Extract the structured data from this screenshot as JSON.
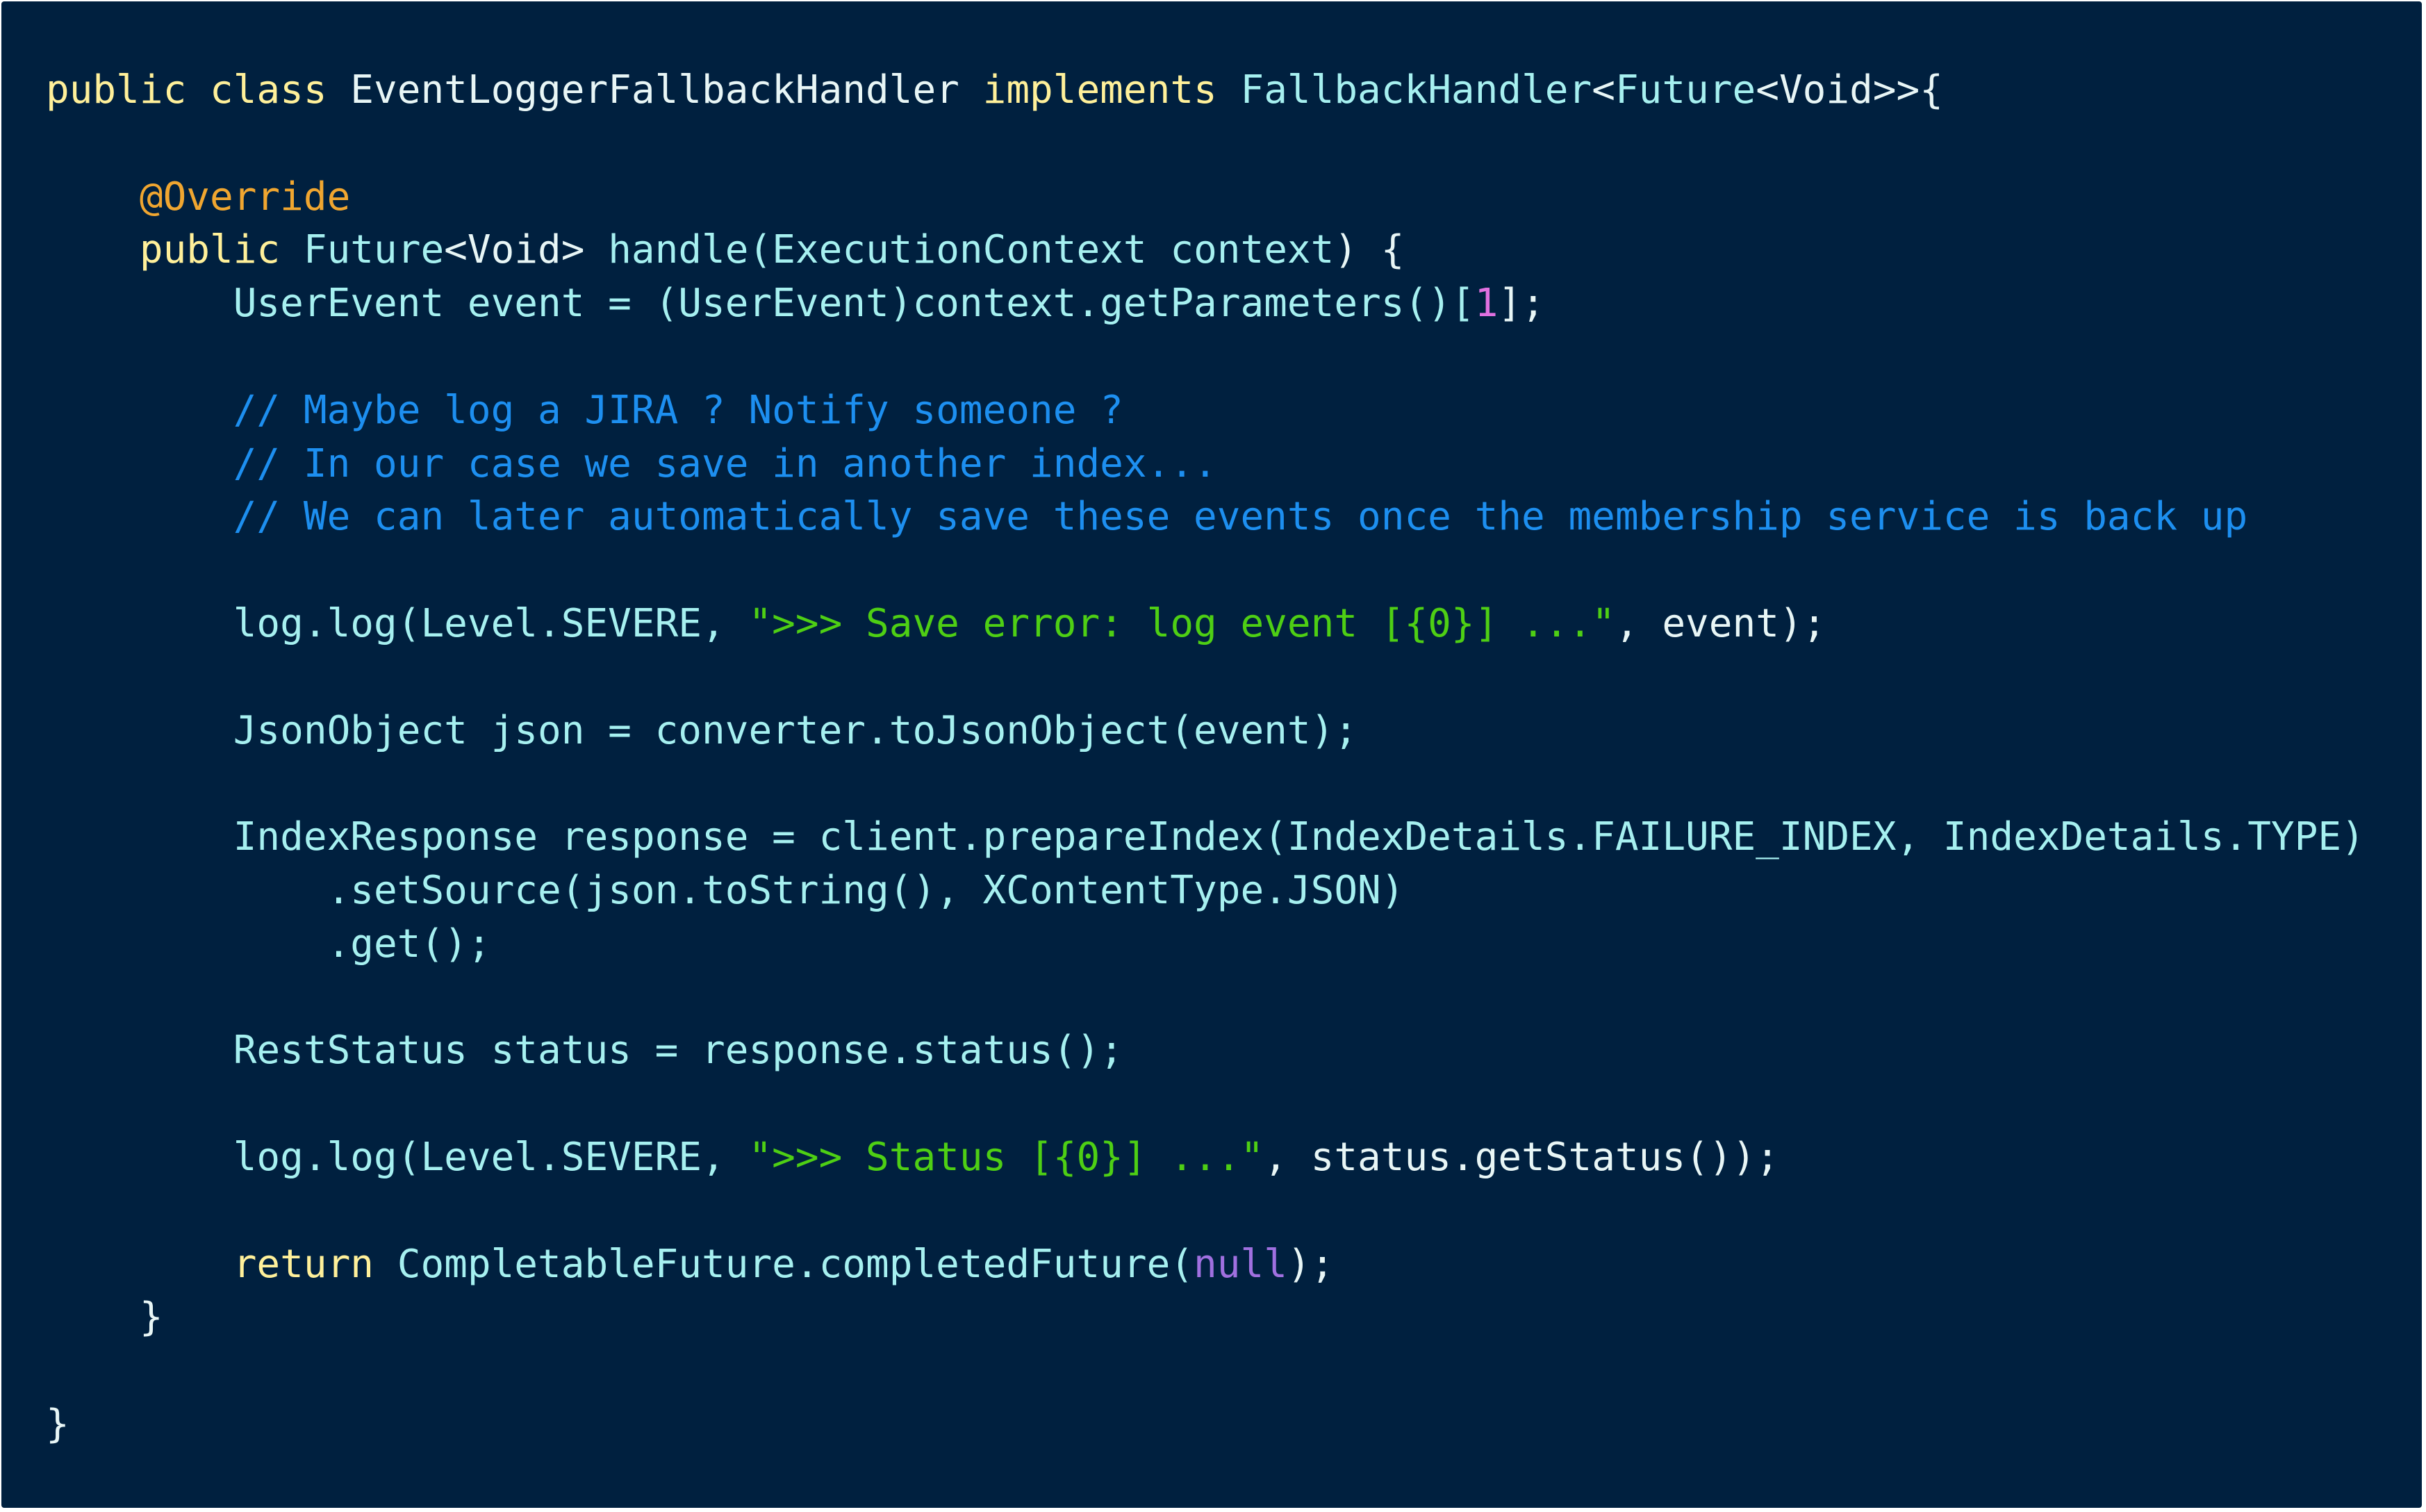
{
  "theme": {
    "background": "#00203f",
    "keyword": "#fff09a",
    "annotation": "#f0a630",
    "type": "#a6f0f0",
    "plain": "#e8f6f6",
    "comment": "#1d8ff0",
    "string": "#4ecf14",
    "number": "#e070e0",
    "null": "#a070e0"
  },
  "code": {
    "language": "java",
    "lines": [
      [
        {
          "text": "public class ",
          "kind": "keyword"
        },
        {
          "text": "EventLoggerFallbackHandler ",
          "kind": "plain"
        },
        {
          "text": "implements ",
          "kind": "keyword"
        },
        {
          "text": "FallbackHandler",
          "kind": "type"
        },
        {
          "text": "<",
          "kind": "plain"
        },
        {
          "text": "Future",
          "kind": "type"
        },
        {
          "text": "<Void>>{",
          "kind": "plain"
        }
      ],
      [],
      [
        {
          "text": "    ",
          "kind": "plain"
        },
        {
          "text": "@Override",
          "kind": "annotation"
        }
      ],
      [
        {
          "text": "    ",
          "kind": "plain"
        },
        {
          "text": "public ",
          "kind": "keyword"
        },
        {
          "text": "Future",
          "kind": "type"
        },
        {
          "text": "<Void> ",
          "kind": "plain"
        },
        {
          "text": "handle(",
          "kind": "type"
        },
        {
          "text": "ExecutionContext context",
          "kind": "type"
        },
        {
          "text": ") {",
          "kind": "plain"
        }
      ],
      [
        {
          "text": "        ",
          "kind": "plain"
        },
        {
          "text": "UserEvent event = (UserEvent)context.getParameters()[",
          "kind": "type"
        },
        {
          "text": "1",
          "kind": "number"
        },
        {
          "text": "];",
          "kind": "plain"
        }
      ],
      [],
      [
        {
          "text": "        ",
          "kind": "plain"
        },
        {
          "text": "// Maybe log a JIRA ? Notify someone ?",
          "kind": "comment"
        }
      ],
      [
        {
          "text": "        ",
          "kind": "plain"
        },
        {
          "text": "// In our case we save in another index...",
          "kind": "comment"
        }
      ],
      [
        {
          "text": "        ",
          "kind": "plain"
        },
        {
          "text": "// We can later automatically save these events once the membership service is back up",
          "kind": "comment"
        }
      ],
      [],
      [
        {
          "text": "        ",
          "kind": "plain"
        },
        {
          "text": "log.log(Level.SEVERE, ",
          "kind": "type"
        },
        {
          "text": "\">>> Save error: log event [{0}] ...\"",
          "kind": "string"
        },
        {
          "text": ", event);",
          "kind": "plain"
        }
      ],
      [],
      [
        {
          "text": "        ",
          "kind": "plain"
        },
        {
          "text": "JsonObject json = converter.toJsonObject(event);",
          "kind": "type"
        }
      ],
      [],
      [
        {
          "text": "        ",
          "kind": "plain"
        },
        {
          "text": "IndexResponse response = client.prepareIndex(IndexDetails.FAILURE_INDEX, IndexDetails.TYPE)",
          "kind": "type"
        }
      ],
      [
        {
          "text": "            ",
          "kind": "plain"
        },
        {
          "text": ".setSource(json.toString(), XContentType.JSON)",
          "kind": "type"
        }
      ],
      [
        {
          "text": "            ",
          "kind": "plain"
        },
        {
          "text": ".get();",
          "kind": "type"
        }
      ],
      [],
      [
        {
          "text": "        ",
          "kind": "plain"
        },
        {
          "text": "RestStatus status = response.status();",
          "kind": "type"
        }
      ],
      [],
      [
        {
          "text": "        ",
          "kind": "plain"
        },
        {
          "text": "log.log(Level.SEVERE, ",
          "kind": "type"
        },
        {
          "text": "\">>> Status [{0}] ...\"",
          "kind": "string"
        },
        {
          "text": ", status.getStatus());",
          "kind": "plain"
        }
      ],
      [],
      [
        {
          "text": "        ",
          "kind": "plain"
        },
        {
          "text": "return ",
          "kind": "keyword"
        },
        {
          "text": "CompletableFuture.completedFuture(",
          "kind": "type"
        },
        {
          "text": "null",
          "kind": "null"
        },
        {
          "text": ");",
          "kind": "plain"
        }
      ],
      [
        {
          "text": "    ",
          "kind": "plain"
        },
        {
          "text": "}",
          "kind": "plain"
        }
      ],
      [],
      [
        {
          "text": "}",
          "kind": "plain"
        }
      ]
    ]
  }
}
